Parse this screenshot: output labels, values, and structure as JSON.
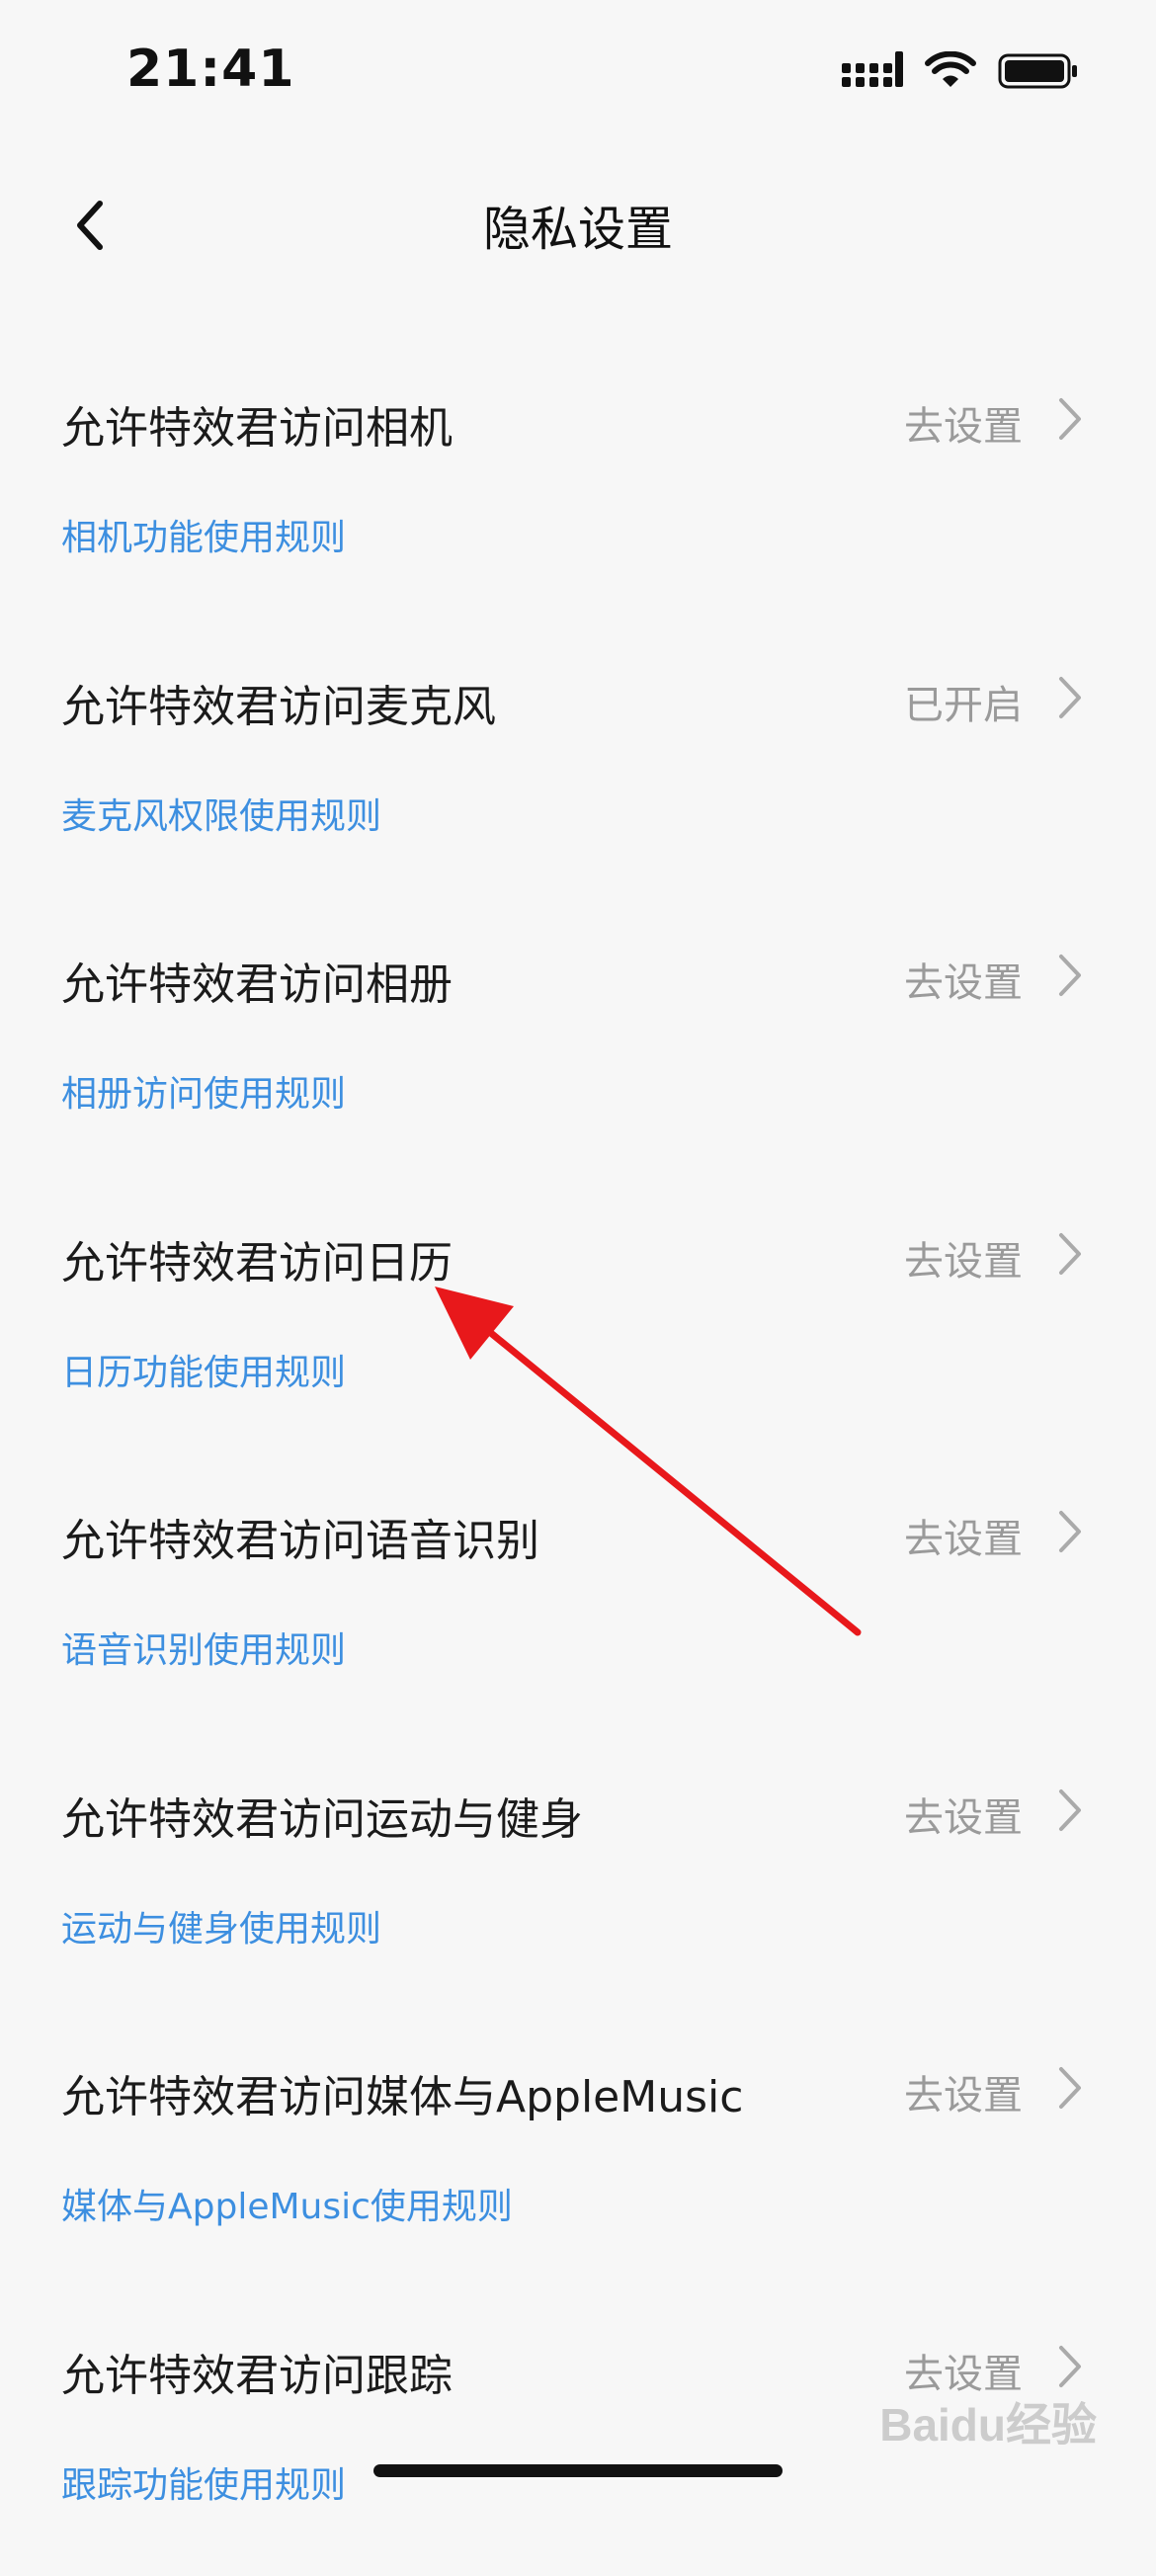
{
  "status_bar": {
    "time": "21:41"
  },
  "nav": {
    "title": "隐私设置"
  },
  "items": [
    {
      "label": "允许特效君访问相机",
      "status": "去设置",
      "rule_link": "相机功能使用规则"
    },
    {
      "label": "允许特效君访问麦克风",
      "status": "已开启",
      "rule_link": "麦克风权限使用规则"
    },
    {
      "label": "允许特效君访问相册",
      "status": "去设置",
      "rule_link": "相册访问使用规则"
    },
    {
      "label": "允许特效君访问日历",
      "status": "去设置",
      "rule_link": "日历功能使用规则"
    },
    {
      "label": "允许特效君访问语音识别",
      "status": "去设置",
      "rule_link": "语音识别使用规则"
    },
    {
      "label": "允许特效君访问运动与健身",
      "status": "去设置",
      "rule_link": "运动与健身使用规则"
    },
    {
      "label": "允许特效君访问媒体与AppleMusic",
      "status": "去设置",
      "rule_link": "媒体与AppleMusic使用规则"
    },
    {
      "label": "允许特效君访问跟踪",
      "status": "去设置",
      "rule_link": "跟踪功能使用规则"
    }
  ],
  "watermark": "Baidu经验",
  "colors": {
    "background": "#f7f7f7",
    "link": "#3d8fe0",
    "status_text": "#9a9a9a",
    "annotation_arrow": "#e8181b"
  }
}
